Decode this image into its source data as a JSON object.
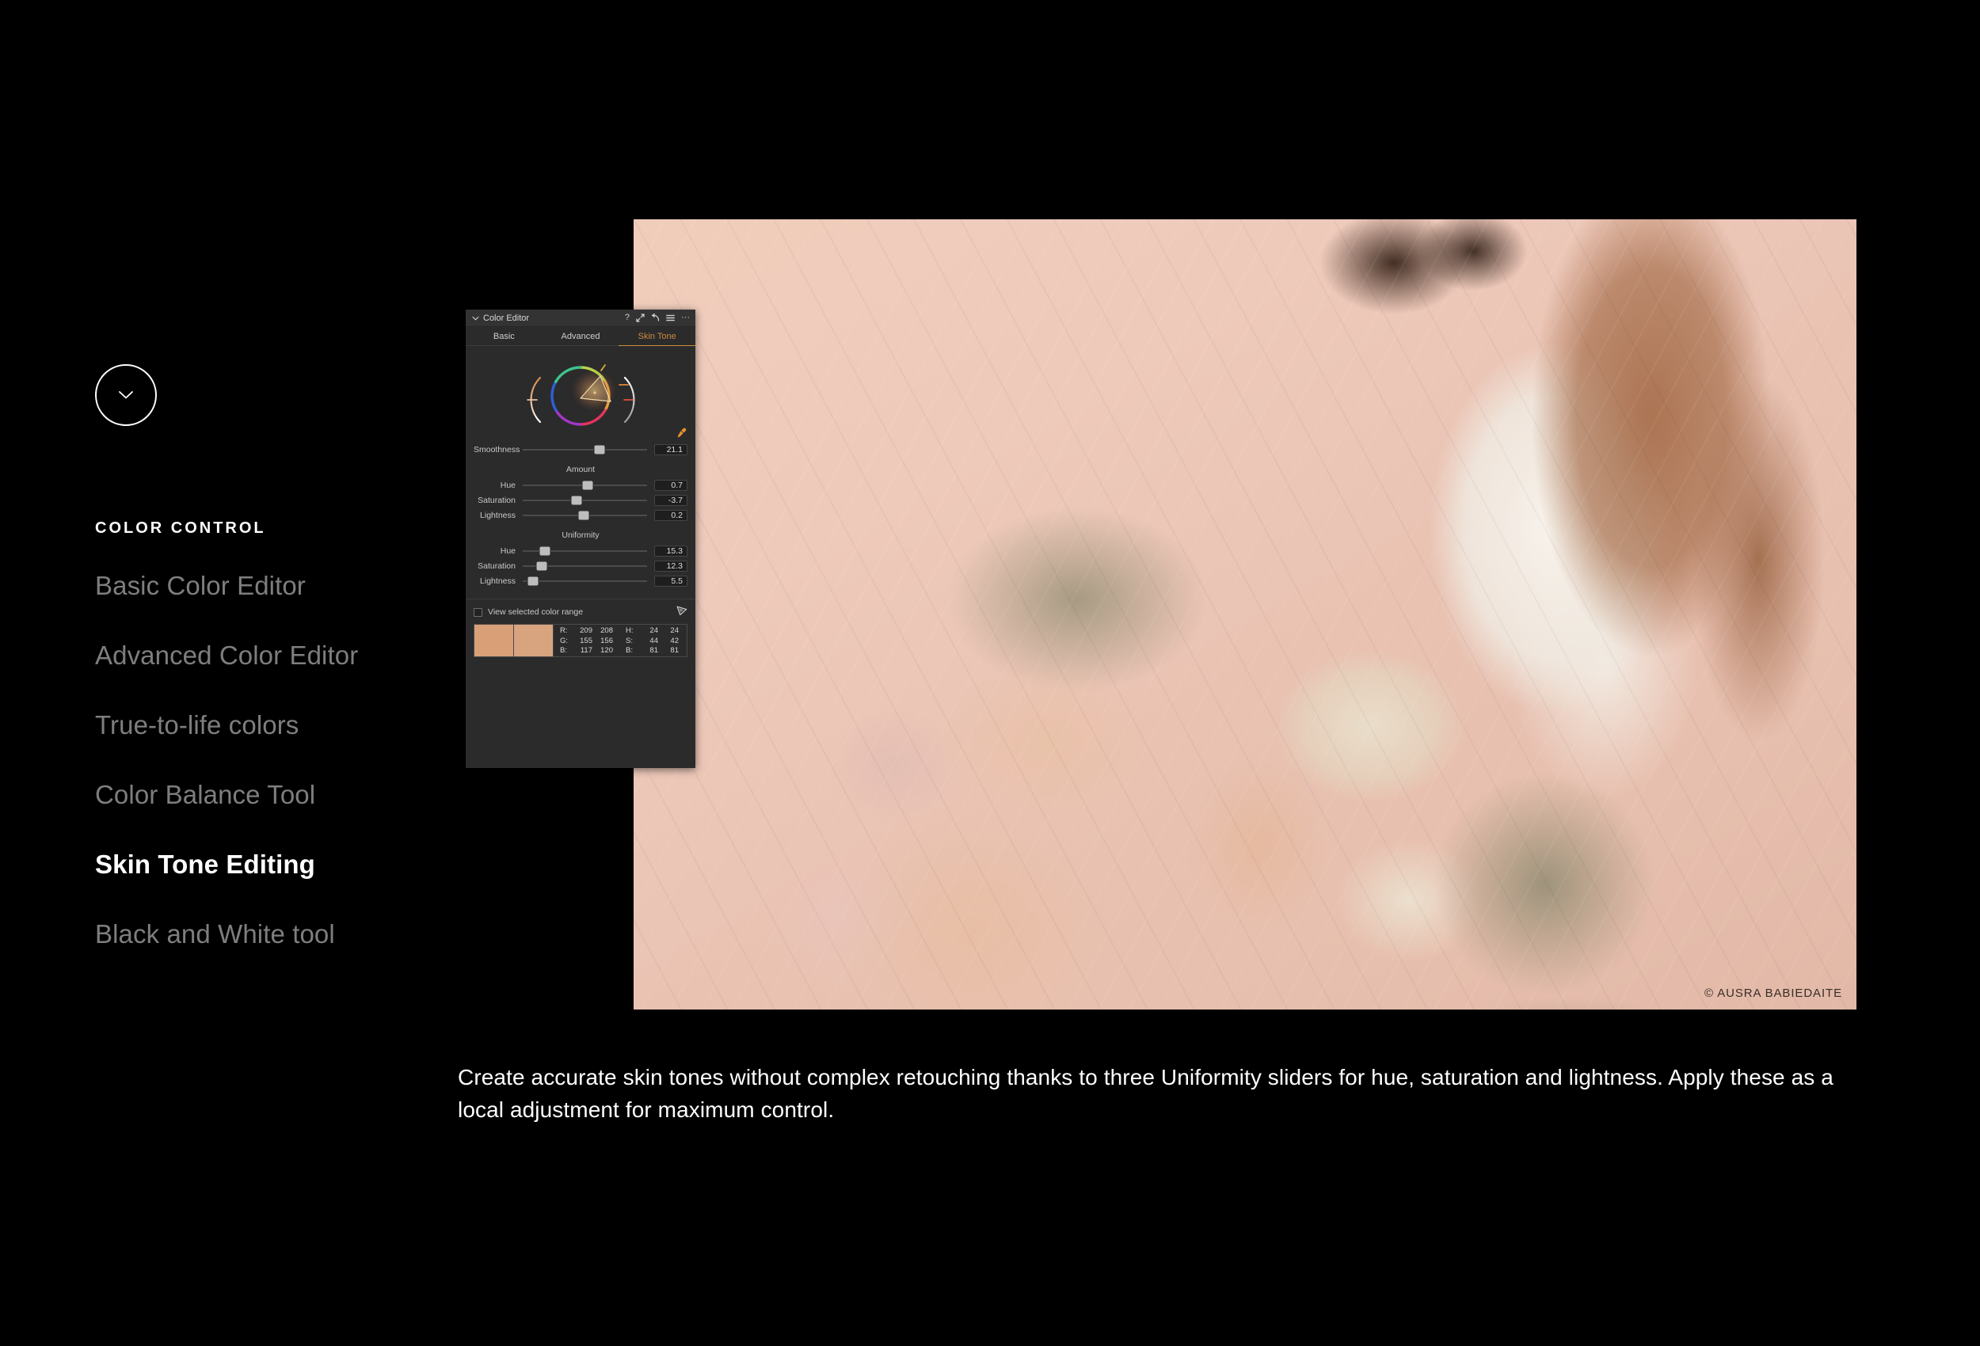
{
  "sidebar": {
    "toggle_icon": "chevron-down-icon",
    "section_label": "COLOR CONTROL",
    "items": [
      {
        "label": "Basic Color Editor",
        "active": false
      },
      {
        "label": "Advanced Color Editor",
        "active": false
      },
      {
        "label": "True-to-life colors",
        "active": false
      },
      {
        "label": "Color Balance Tool",
        "active": false
      },
      {
        "label": "Skin Tone Editing",
        "active": true
      },
      {
        "label": "Black and White tool",
        "active": false
      }
    ]
  },
  "photo": {
    "credit": "© AUSRA BABIEDAITE"
  },
  "panel": {
    "title": "Color Editor",
    "collapse_icon": "chevron-down-icon",
    "titlebar_icons": [
      {
        "name": "help-icon",
        "glyph": "?"
      },
      {
        "name": "expand-icon",
        "glyph": "⤢"
      },
      {
        "name": "reset-icon",
        "glyph": "↰"
      },
      {
        "name": "menu-icon",
        "glyph": "≡"
      },
      {
        "name": "more-icon",
        "glyph": "···"
      }
    ],
    "tabs": [
      {
        "label": "Basic",
        "active": false
      },
      {
        "label": "Advanced",
        "active": false
      },
      {
        "label": "Skin Tone",
        "active": true
      }
    ],
    "accent_color": "#cf8b3c",
    "picker_icon": "eyedropper-icon",
    "smoothness": {
      "label": "Smoothness",
      "value": "21.1",
      "pos": 62
    },
    "amount": {
      "heading": "Amount",
      "sliders": [
        {
          "label": "Hue",
          "value": "0.7",
          "pos": 52
        },
        {
          "label": "Saturation",
          "value": "-3.7",
          "pos": 43
        },
        {
          "label": "Lightness",
          "value": "0.2",
          "pos": 49
        }
      ]
    },
    "uniformity": {
      "heading": "Uniformity",
      "sliders": [
        {
          "label": "Hue",
          "value": "15.3",
          "pos": 18
        },
        {
          "label": "Saturation",
          "value": "12.3",
          "pos": 15
        },
        {
          "label": "Lightness",
          "value": "5.5",
          "pos": 8
        }
      ]
    },
    "view_range": {
      "label": "View selected color range",
      "checked": false,
      "icon": "color-range-icon"
    },
    "swatches": [
      {
        "name": "swatch-before",
        "color": "#d9a078"
      },
      {
        "name": "swatch-after",
        "color": "#d8a37f"
      }
    ],
    "readout": {
      "rgb": [
        {
          "key": "R:",
          "v1": "209",
          "v2": "208"
        },
        {
          "key": "G:",
          "v1": "155",
          "v2": "156"
        },
        {
          "key": "B:",
          "v1": "117",
          "v2": "120"
        }
      ],
      "hsb": [
        {
          "key": "H:",
          "v1": "24",
          "v2": "24"
        },
        {
          "key": "S:",
          "v1": "44",
          "v2": "42"
        },
        {
          "key": "B:",
          "v1": "81",
          "v2": "81"
        }
      ]
    }
  },
  "caption": {
    "text": "Create accurate skin tones without complex retouching thanks to three Uniformity sliders for hue, saturation and lightness. Apply these as a local adjustment for maximum control."
  }
}
